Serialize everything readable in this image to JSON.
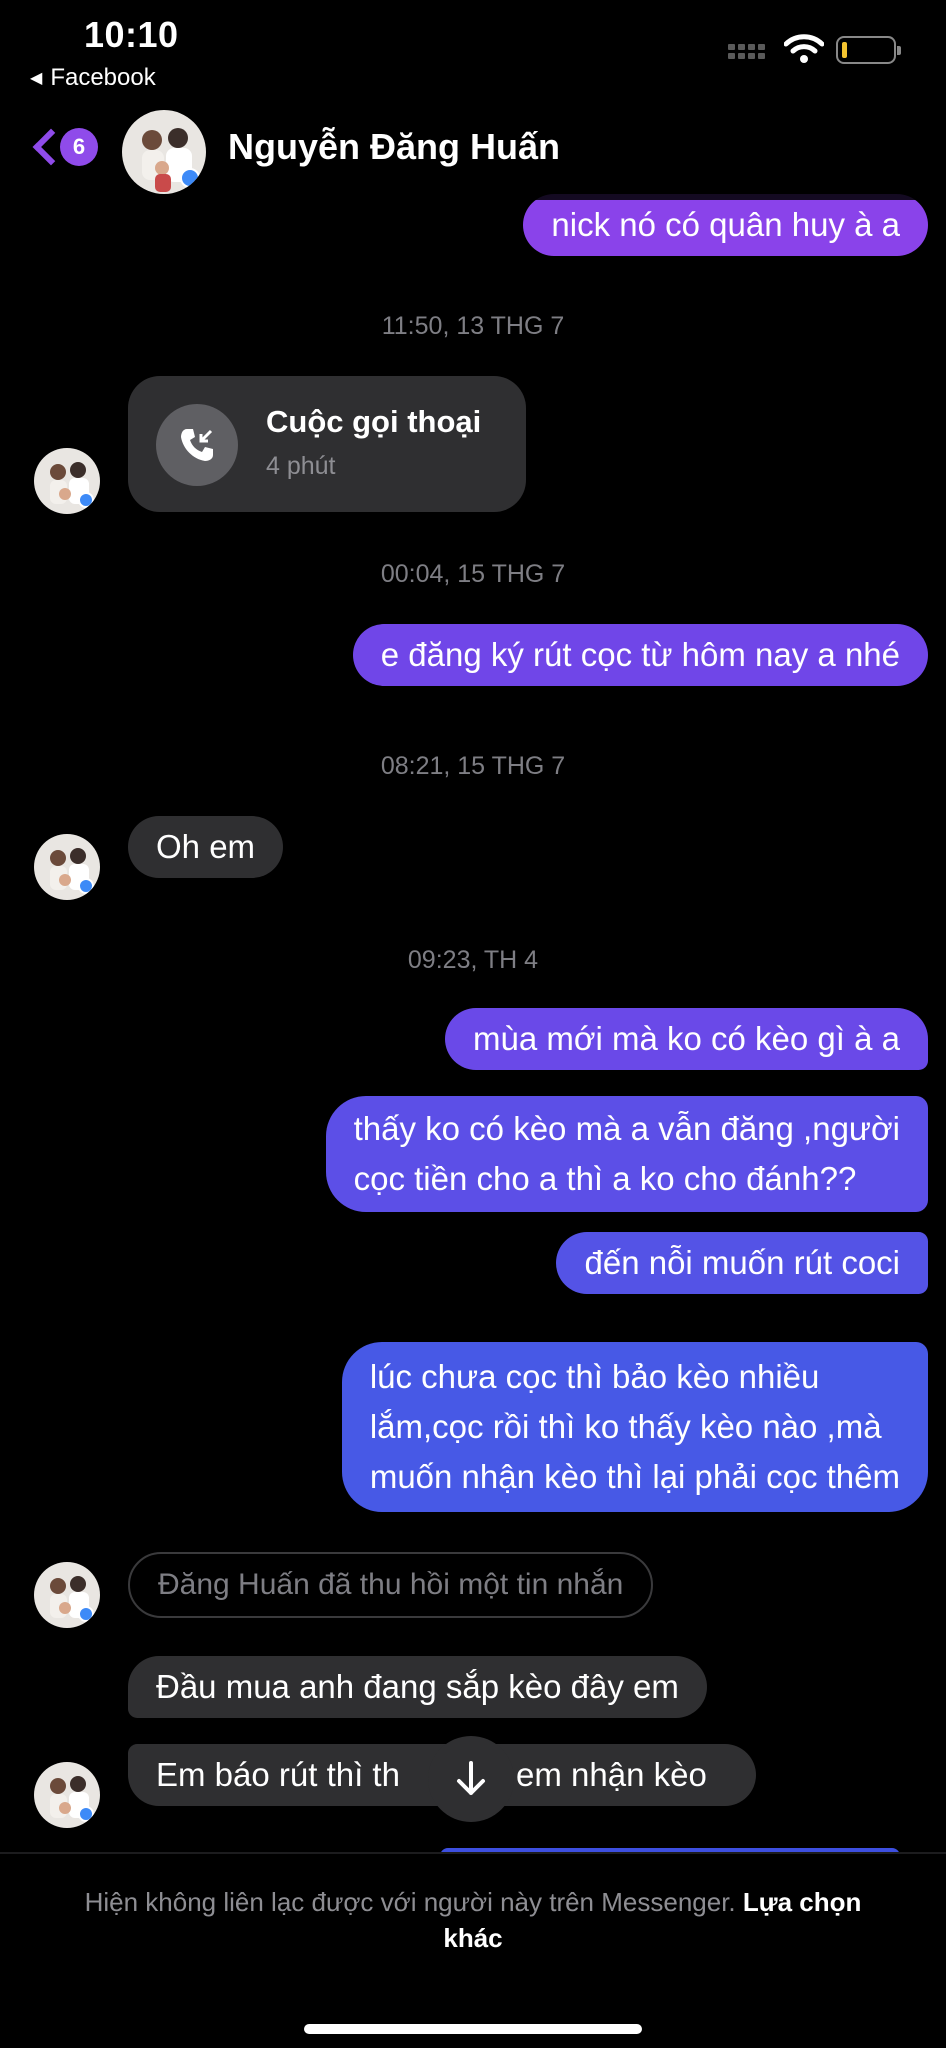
{
  "status_bar": {
    "time": "10:10",
    "back_app": "Facebook",
    "battery_level": 0.05
  },
  "header": {
    "unread_count": "6",
    "contact_name": "Nguyễn Đăng Huấn"
  },
  "messages": {
    "m0": "nick nó có quân huy à a",
    "ts1": "11:50, 13 THG 7",
    "call": {
      "title": "Cuộc gọi thoại",
      "duration": "4 phút"
    },
    "ts2": "00:04, 15 THG 7",
    "m1": "e đăng ký rút cọc từ hôm nay a nhé",
    "ts3": "08:21, 15 THG 7",
    "m2": "Oh em",
    "ts4": "09:23, TH 4",
    "m3": "mùa mới mà ko có kèo gì à a",
    "m4_line1": "thấy ko có kèo mà a vẫn đăng ,người",
    "m4_line2": "cọc tiền cho a thì a ko cho đánh??",
    "m5": "đến nỗi muốn rút coci",
    "m6_line1": "lúc chưa cọc thì bảo kèo nhiều",
    "m6_line2": "lắm,cọc rồi thì ko thấy kèo nào ,mà",
    "m6_line3": "muốn nhận kèo thì lại phải cọc thêm",
    "recall": "Đăng Huấn đã thu hồi một tin nhắn",
    "m7": "Đầu mua anh đang sắp kèo đây em",
    "m8_left": "Em báo rút thì th",
    "m8_right": "em nhận kèo"
  },
  "footer": {
    "notice": "Hiện không liên lạc được với người này trên Messenger.",
    "link": "Lựa chọn khác"
  },
  "colors": {
    "accent": "#8f4bea",
    "out_top": "#8a43ea",
    "out_bottom": "#3f5ce5",
    "incoming": "#2f2f31"
  }
}
